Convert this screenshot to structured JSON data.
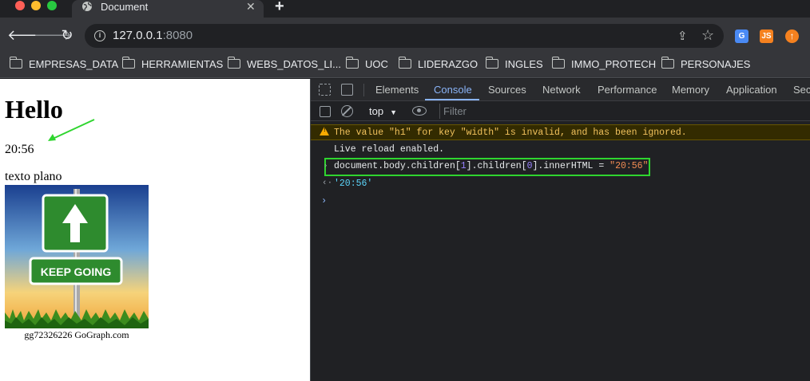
{
  "browser": {
    "tab_title": "Document",
    "url_host": "127.0.0.1",
    "url_port": ":8080",
    "extensions": {
      "js": "JS"
    },
    "bookmarks": [
      "EMPRESAS_DATA",
      "HERRAMIENTAS",
      "WEBS_DATOS_LI...",
      "UOC",
      "LIDERAZGO",
      "INGLES",
      "IMMO_PROTECH",
      "PERSONAJES"
    ]
  },
  "page": {
    "heading": "Hello",
    "time_text": "20:56",
    "plain_text": "texto plano",
    "sign_text": "KEEP GOING",
    "image_caption": "gg72326226 GoGraph.com"
  },
  "devtools": {
    "tabs": [
      "Elements",
      "Console",
      "Sources",
      "Network",
      "Performance",
      "Memory",
      "Application",
      "Sec"
    ],
    "active_tab": "Console",
    "context": "top",
    "filter_placeholder": "Filter",
    "warning": "The value \"h1\" for key \"width\" is invalid, and has been ignored.",
    "log": "Live reload enabled.",
    "command": {
      "p1": "document",
      "p2": ".",
      "p3": "body",
      "p4": ".",
      "p5": "children",
      "p6": "[",
      "p7": "1",
      "p8": "].",
      "p9": "children",
      "p10": "[",
      "p11": "0",
      "p12": "].",
      "p13": "innerHTML",
      "p14": " = ",
      "p15": "\"20:56\""
    },
    "result": "'20:56'"
  },
  "colors": {
    "highlight_box": "#2fd52f",
    "annotation_arrow": "#2fd52f",
    "active_tab": "#8ab4f8",
    "warning_text": "#f2c25d"
  }
}
